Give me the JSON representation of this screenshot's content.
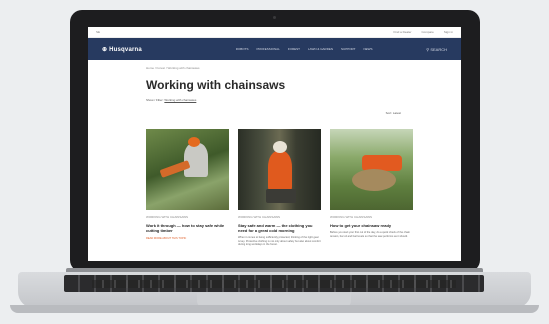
{
  "topbar": {
    "left": "SE",
    "links": [
      "Find a Dealer",
      "Compare",
      "Sign in"
    ]
  },
  "navbar": {
    "logo": "Husqvarna",
    "links": [
      "ROBOTS",
      "PROFESSIONAL",
      "FOREST",
      "LAWN & GARDEN",
      "SUPPORT",
      "NEWS"
    ],
    "search": "SEARCH"
  },
  "breadcrumb": "Home / Forest / Working with chainsaws",
  "page": {
    "title": "Working with chainsaws",
    "showing_label": "Show / Filter:",
    "showing_tag": "Working with chainsaws",
    "sort": "Sort: Latest"
  },
  "cards": [
    {
      "category": "WORKING WITH CHAINSAWS",
      "title": "Work it through — how to stay safe while cutting timber",
      "desc": "",
      "more": "READ MORE ABOUT THIS TOPIC"
    },
    {
      "category": "WORKING WITH CHAINSAWS",
      "title": "Stay safe and warm — the clothing you need for a great cold morning",
      "desc": "When it comes to being sufficiently protected, thinking of the right gear is key. Protective clothing is not only about safety but also about comfort during long workdays in the forest.",
      "more": ""
    },
    {
      "category": "WORKING WITH CHAINSAWS",
      "title": "How to get your chainsaw ready",
      "desc": "Before you start your first cut of the day, do a quick check of the chain tension, bar oil and fuel levels so that the saw performs as it should.",
      "more": ""
    }
  ],
  "colors": {
    "nav": "#273a60",
    "accent": "#e0602a",
    "lid": "#1d1d1f"
  }
}
